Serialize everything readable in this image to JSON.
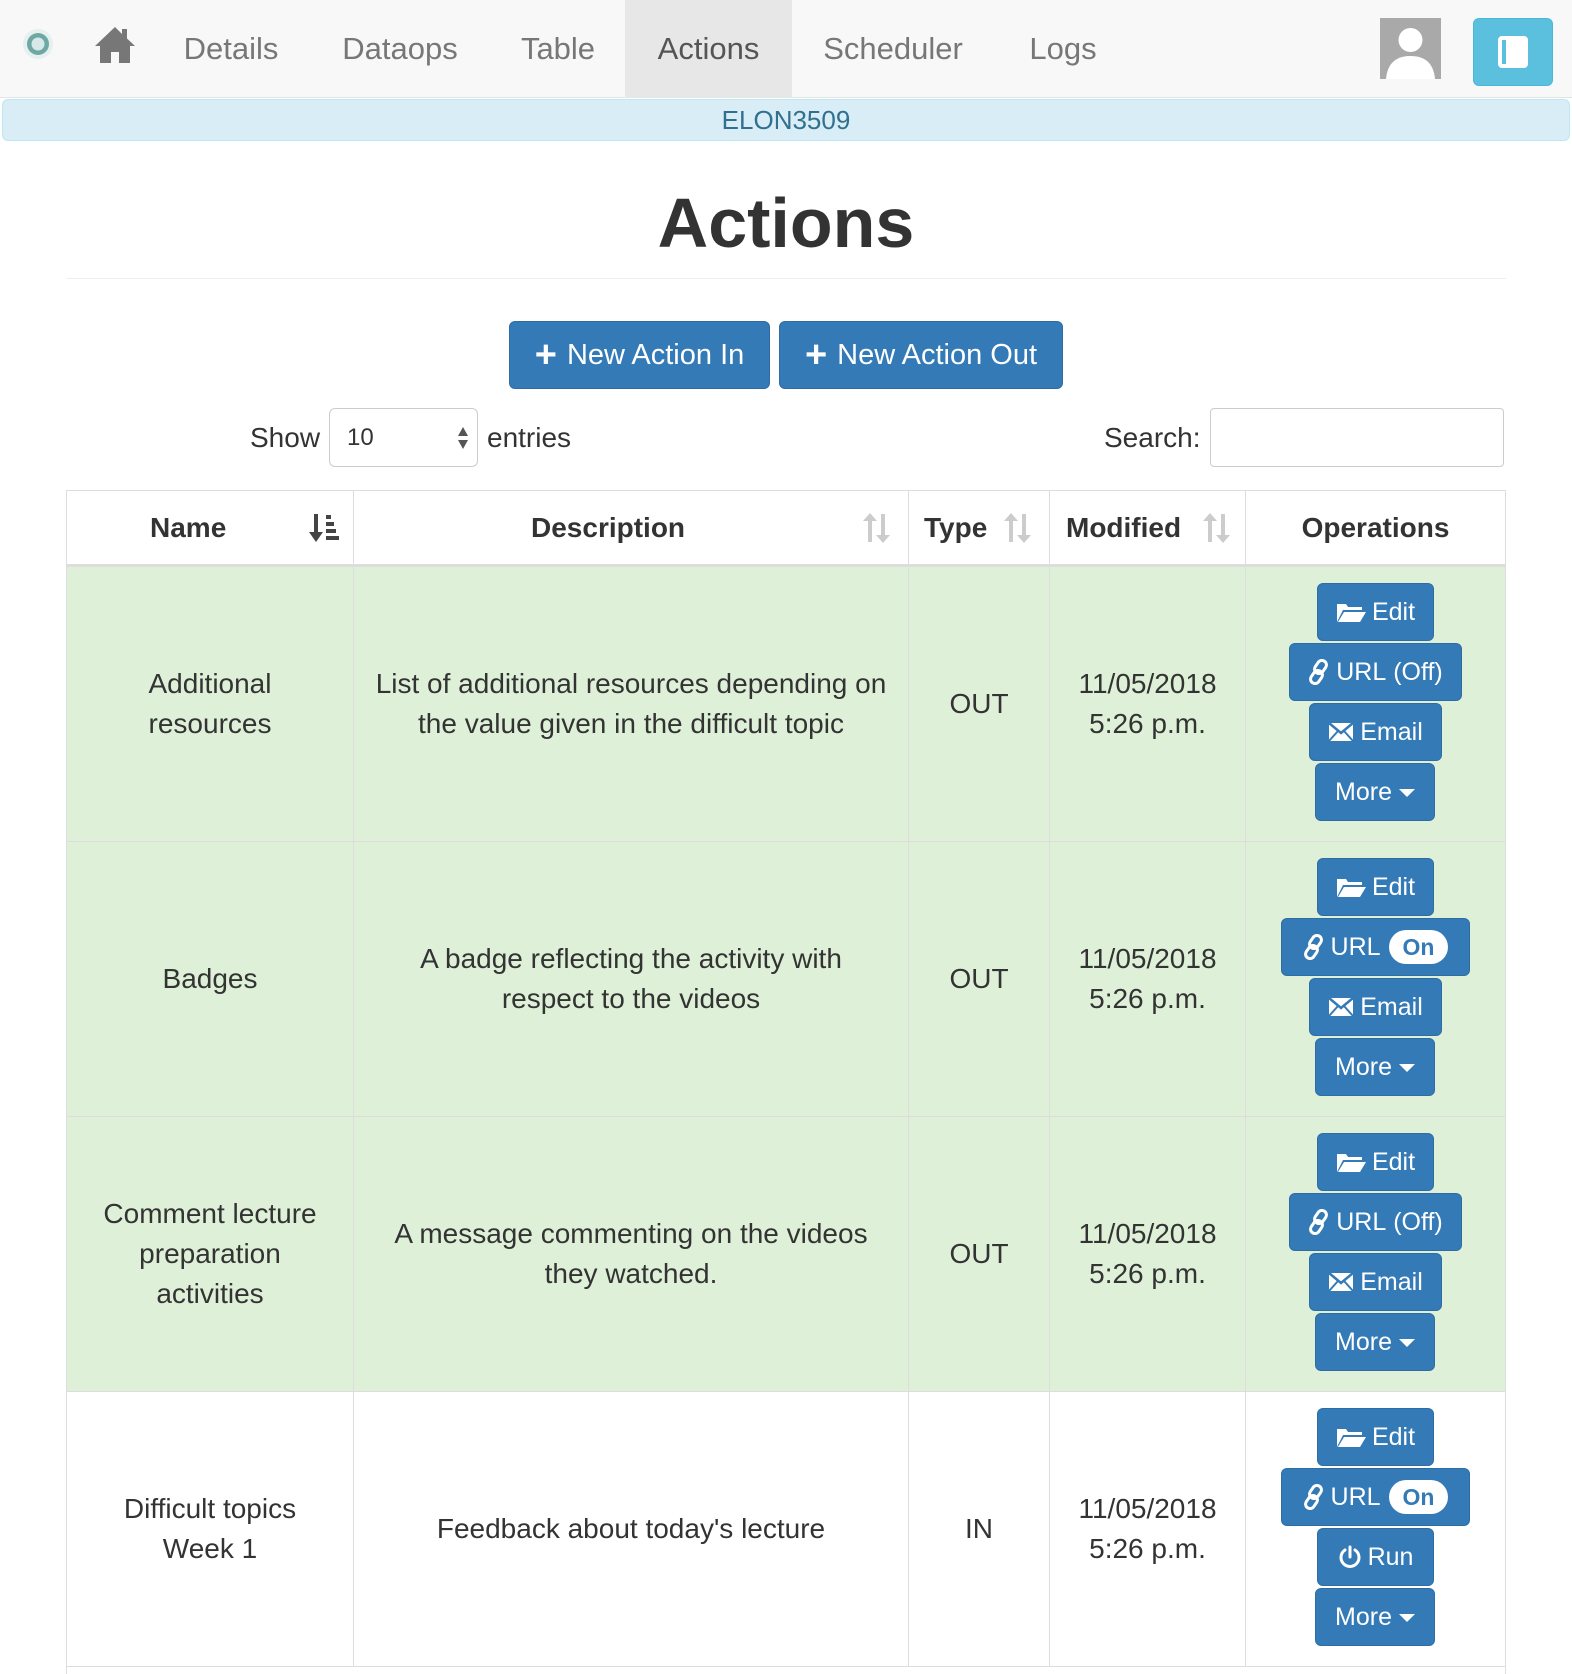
{
  "navbar": {
    "items": [
      "Details",
      "Dataops",
      "Table",
      "Actions",
      "Scheduler",
      "Logs"
    ],
    "active": "Actions"
  },
  "workflow": {
    "name": "ELON3509"
  },
  "page": {
    "title": "Actions"
  },
  "buttons": {
    "new_action_in": "New Action In",
    "new_action_out": "New Action Out"
  },
  "table_controls": {
    "show_label": "Show",
    "entries_value": "10",
    "entries_label": "entries",
    "search_label": "Search:"
  },
  "table": {
    "columns": [
      "Name",
      "Description",
      "Type",
      "Modified",
      "Operations"
    ],
    "rows": [
      {
        "name": "Additional resources",
        "description": "List of additional resources depending on the value given in the difficult topic",
        "type": "OUT",
        "modified": "11/05/2018 5:26 p.m.",
        "ops": {
          "edit": "Edit",
          "url": "URL",
          "url_state": "(Off)",
          "third": "Email",
          "more": "More"
        }
      },
      {
        "name": "Badges",
        "description": "A badge reflecting the activity with respect to the videos",
        "type": "OUT",
        "modified": "11/05/2018 5:26 p.m.",
        "ops": {
          "edit": "Edit",
          "url": "URL",
          "url_state": "On",
          "third": "Email",
          "more": "More"
        }
      },
      {
        "name": "Comment lecture preparation activities",
        "description": "A message commenting on the videos they watched.",
        "type": "OUT",
        "modified": "11/05/2018 5:26 p.m.",
        "ops": {
          "edit": "Edit",
          "url": "URL",
          "url_state": "(Off)",
          "third": "Email",
          "more": "More"
        }
      },
      {
        "name": "Difficult topics Week 1",
        "description": "Feedback about today's lecture",
        "type": "IN",
        "modified": "11/05/2018 5:26 p.m.",
        "ops": {
          "edit": "Edit",
          "url": "URL",
          "url_state": "On",
          "third": "Run",
          "more": "More"
        }
      }
    ]
  },
  "colors": {
    "primary": "#337ab7",
    "row_highlight": "#dff0d8",
    "info_bar": "#d9edf7",
    "info_button": "#5bc0de"
  },
  "icons": [
    "logo-icon",
    "home-icon",
    "avatar-icon",
    "book-icon",
    "plus-icon",
    "sort-icon",
    "folder-open-icon",
    "link-icon",
    "envelope-icon",
    "power-icon",
    "caret-down-icon"
  ]
}
